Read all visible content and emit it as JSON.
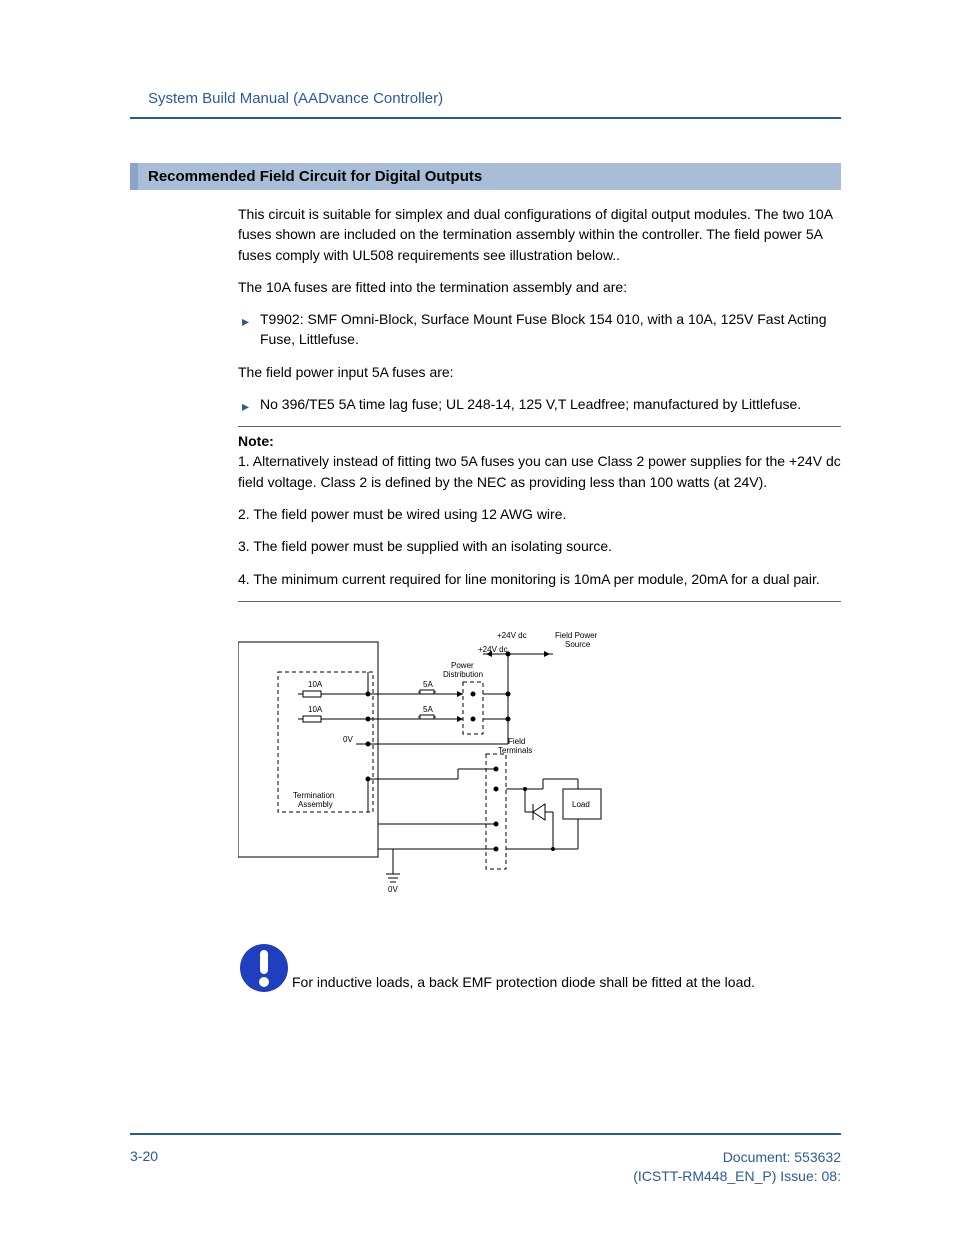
{
  "header": {
    "title": "System Build Manual  (AADvance Controller)"
  },
  "section": {
    "heading": "Recommended Field Circuit for Digital Outputs",
    "para1": "This circuit is suitable for simplex and dual configurations of digital output modules. The two 10A fuses shown are included on the termination assembly within the controller. The field power 5A fuses comply with UL508 requirements see illustration below..",
    "para2": "The 10A fuses are fitted into the termination assembly and are:",
    "bullet1": "T9902:  SMF Omni-Block, Surface Mount Fuse Block 154 010, with a 10A, 125V Fast Acting Fuse, Littlefuse.",
    "para3": "The field power input 5A fuses are:",
    "bullet2": "No 396/TE5  5A time lag fuse; UL 248-14, 125 V,T Leadfree; manufactured by Littlefuse.",
    "note_label": "Note:",
    "note1": "1. Alternatively instead of fitting two 5A fuses you can use Class 2 power supplies for the +24V dc field voltage. Class 2 is defined by the NEC as providing less than 100 watts (at 24V).",
    "note2": "2. The field power must be wired using 12 AWG wire.",
    "note3": "3. The field power must be supplied with an isolating source.",
    "note4": "4. The minimum current required for line monitoring is 10mA per module, 20mA for a dual pair.",
    "warning_text": "For inductive loads, a back EMF protection diode shall be fitted at the load."
  },
  "diagram": {
    "label_24v_top": "+24V dc",
    "label_24v_mid": "+24V dc",
    "label_field_power_source": "Field Power Source",
    "label_power_distribution": "Power Distribution",
    "label_10a_1": "10A",
    "label_10a_2": "10A",
    "label_5a_1": "5A",
    "label_5a_2": "5A",
    "label_0v_left": "0V",
    "label_0v_bottom": "0V",
    "label_field_terminals": "Field Terminals",
    "label_termination_assembly": "Termination Assembly",
    "label_load": "Load"
  },
  "footer": {
    "page_num": "3-20",
    "doc_line1": "Document: 553632",
    "doc_line2": "(ICSTT-RM448_EN_P) Issue: 08:"
  }
}
